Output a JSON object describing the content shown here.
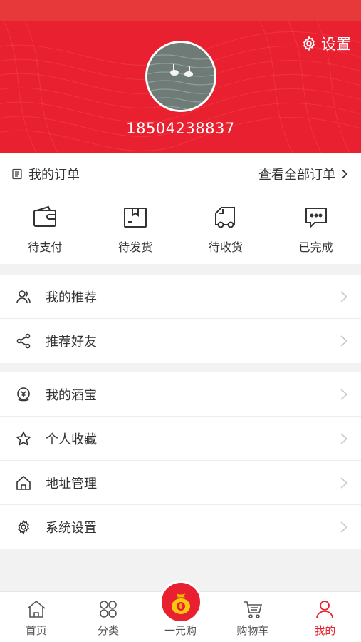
{
  "colors": {
    "brand_red": "#e8202f",
    "status_red": "#e8393a"
  },
  "header": {
    "settings_label": "设置",
    "phone": "18504238837",
    "avatar_icon": "user-avatar-photo"
  },
  "orders": {
    "title": "我的订单",
    "view_all": "查看全部订单",
    "items": [
      {
        "label": "待支付",
        "icon": "wallet-icon"
      },
      {
        "label": "待发货",
        "icon": "box-icon"
      },
      {
        "label": "待收货",
        "icon": "truck-icon"
      },
      {
        "label": "已完成",
        "icon": "chat-icon"
      }
    ]
  },
  "menu": {
    "group1": [
      {
        "label": "我的推荐",
        "icon": "users-icon"
      },
      {
        "label": "推荐好友",
        "icon": "share-icon"
      }
    ],
    "group2": [
      {
        "label": "我的酒宝",
        "icon": "coin-icon"
      },
      {
        "label": "个人收藏",
        "icon": "star-icon"
      },
      {
        "label": "地址管理",
        "icon": "home-icon"
      },
      {
        "label": "系统设置",
        "icon": "gear-icon"
      }
    ]
  },
  "tabbar": {
    "items": [
      {
        "label": "首页",
        "icon": "home-icon"
      },
      {
        "label": "分类",
        "icon": "grid-icon"
      },
      {
        "label": "一元购",
        "icon": "moneybag-icon"
      },
      {
        "label": "购物车",
        "icon": "cart-icon"
      },
      {
        "label": "我的",
        "icon": "person-icon",
        "active": true
      }
    ]
  }
}
